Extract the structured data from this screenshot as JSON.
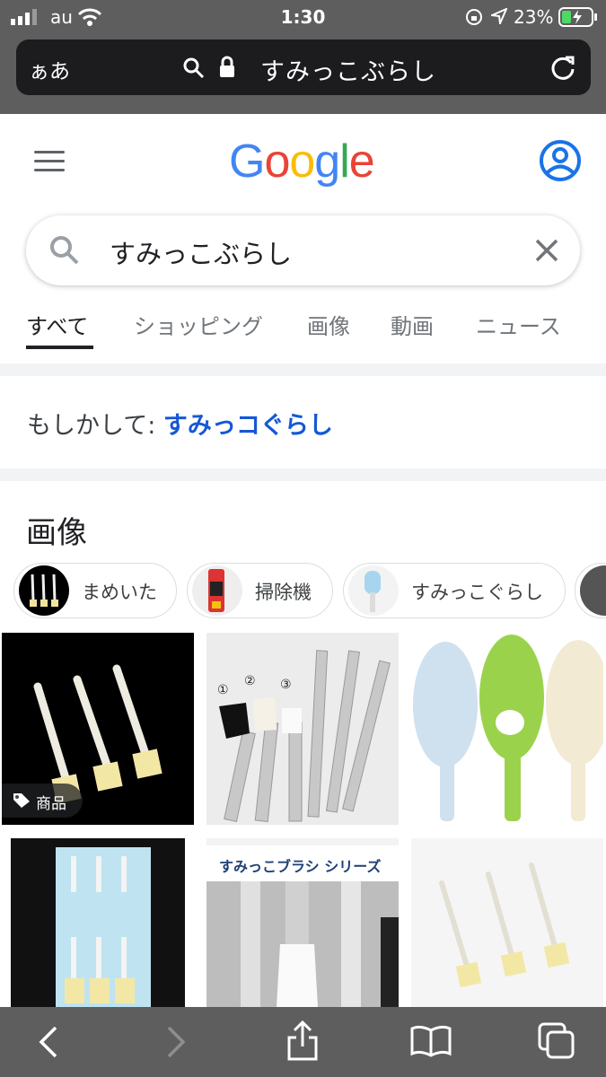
{
  "status_bar": {
    "carrier": "au",
    "time": "1:30",
    "battery": "23%"
  },
  "safari": {
    "reader_label": "ぁあ",
    "url_text": "すみっこぶらし"
  },
  "google": {
    "logo": [
      "G",
      "o",
      "o",
      "g",
      "l",
      "e"
    ],
    "logo_colors": [
      "#4285f4",
      "#ea4335",
      "#fbbc05",
      "#4285f4",
      "#34a853",
      "#ea4335"
    ]
  },
  "search": {
    "query": "すみっこぶらし"
  },
  "tabs": [
    "すべて",
    "ショッピング",
    "画像",
    "動画",
    "ニュース"
  ],
  "did_you_mean": {
    "prefix": "もしかして:",
    "suggestion": "すみっコぐらし"
  },
  "images": {
    "title": "画像",
    "chips": [
      "まめいた",
      "掃除機",
      "すみっこぐらし"
    ],
    "product_badge": "商品",
    "banner_text": "すみっこブラシ シリーズ"
  },
  "toolbar": {
    "icons": [
      "back-icon",
      "forward-icon",
      "share-icon",
      "bookmarks-icon",
      "tabs-icon"
    ]
  }
}
